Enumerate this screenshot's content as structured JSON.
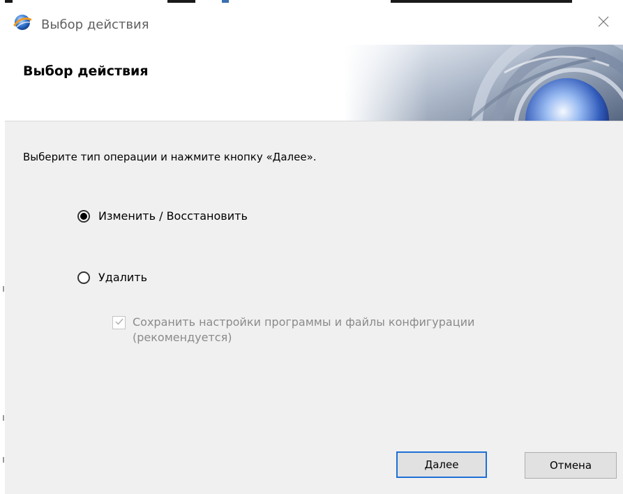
{
  "window": {
    "title": "Выбор действия"
  },
  "header": {
    "title": "Выбор действия"
  },
  "main": {
    "instruction": "Выберите тип операции и нажмите кнопку «Далее».",
    "options": [
      {
        "label": "Изменить / Восстановить",
        "selected": true
      },
      {
        "label": "Удалить",
        "selected": false
      }
    ],
    "keep_settings": {
      "label": "Сохранить настройки программы и файлы конфигурации (рекомендуется)",
      "checked": true,
      "enabled": false
    }
  },
  "footer": {
    "next_label": "Далее",
    "cancel_label": "Отмена"
  },
  "icons": {
    "app": "app-logo-icon",
    "close": "close-icon",
    "checkmark": "checkmark-icon"
  },
  "colors": {
    "dialog_background": "#f0f0f0",
    "header_background": "#ffffff",
    "default_button_border": "#1d6fd6",
    "disabled_text": "#8a8a8a"
  }
}
